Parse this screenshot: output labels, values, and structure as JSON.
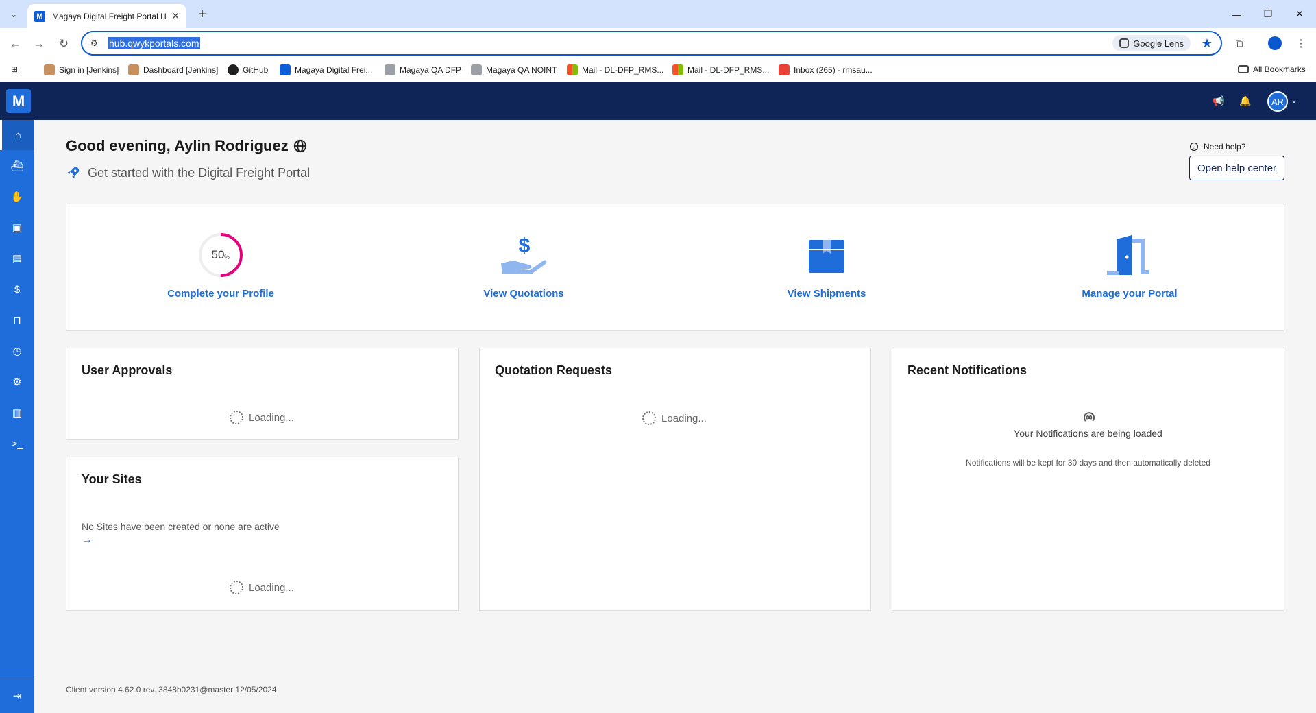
{
  "browser": {
    "tab_title": "Magaya Digital Freight Portal H",
    "tab_close": "✕",
    "new_tab": "+",
    "url": "hub.qwykportals.com",
    "lens_label": "Google Lens",
    "window": {
      "minimize": "—",
      "restore": "❐",
      "close": "✕"
    },
    "bookmarks": [
      {
        "label": "Sign in [Jenkins]",
        "icon": "jenkins-icon",
        "color": "#c6905f"
      },
      {
        "label": "Dashboard [Jenkins]",
        "icon": "jenkins-icon",
        "color": "#c6905f"
      },
      {
        "label": "GitHub",
        "icon": "github-icon",
        "color": "#1f1f1f"
      },
      {
        "label": "Magaya Digital Frei...",
        "icon": "magaya-icon",
        "color": "#0b5ed7"
      },
      {
        "label": "Magaya QA DFP",
        "icon": "magaya-m-icon",
        "color": "#9aa0a6"
      },
      {
        "label": "Magaya QA NOINT",
        "icon": "magaya-m-icon",
        "color": "#9aa0a6"
      },
      {
        "label": "Mail - DL-DFP_RMS...",
        "icon": "microsoft-icon",
        "color": "#f35325"
      },
      {
        "label": "Mail - DL-DFP_RMS...",
        "icon": "microsoft-icon",
        "color": "#f35325"
      },
      {
        "label": "Inbox (265) - rmsau...",
        "icon": "gmail-icon",
        "color": "#ea4335"
      }
    ],
    "all_bookmarks": "All Bookmarks"
  },
  "app": {
    "logo": "M",
    "avatar_initials": "AR",
    "brand_color": "#1e6ddb",
    "header_color": "#0f2557",
    "sidebar_icons": [
      "home-icon",
      "ship-icon",
      "quote-icon",
      "package-icon",
      "document-icon",
      "dollar-icon",
      "portal-icon",
      "clock-icon",
      "gear-icon",
      "library-icon",
      "terminal-icon"
    ],
    "sidebar_expand_icon": "expand-icon"
  },
  "main": {
    "greeting": "Good evening, Aylin Rodriguez",
    "subtitle": "Get started with the Digital Freight Portal",
    "need_help": "Need help?",
    "help_button": "Open help center",
    "quick_actions": [
      {
        "label": "Complete your Profile",
        "icon": "progress-ring",
        "progress": 50,
        "progress_text": "50",
        "progress_unit": "%"
      },
      {
        "label": "View Quotations",
        "icon": "quotation-hand-icon"
      },
      {
        "label": "View Shipments",
        "icon": "shipment-box-icon"
      },
      {
        "label": "Manage your Portal",
        "icon": "portal-door-icon"
      }
    ],
    "user_approvals": {
      "title": "User Approvals",
      "loading": "Loading..."
    },
    "quotation_requests": {
      "title": "Quotation Requests",
      "loading": "Loading..."
    },
    "recent_notifications": {
      "title": "Recent Notifications",
      "status": "Your Notifications are being loaded",
      "note": "Notifications will be kept for 30 days and then automatically deleted"
    },
    "your_sites": {
      "title": "Your Sites",
      "empty": "No Sites have been created or none are active",
      "loading": "Loading..."
    },
    "footer": "Client version 4.62.0 rev. 3848b0231@master 12/05/2024"
  }
}
